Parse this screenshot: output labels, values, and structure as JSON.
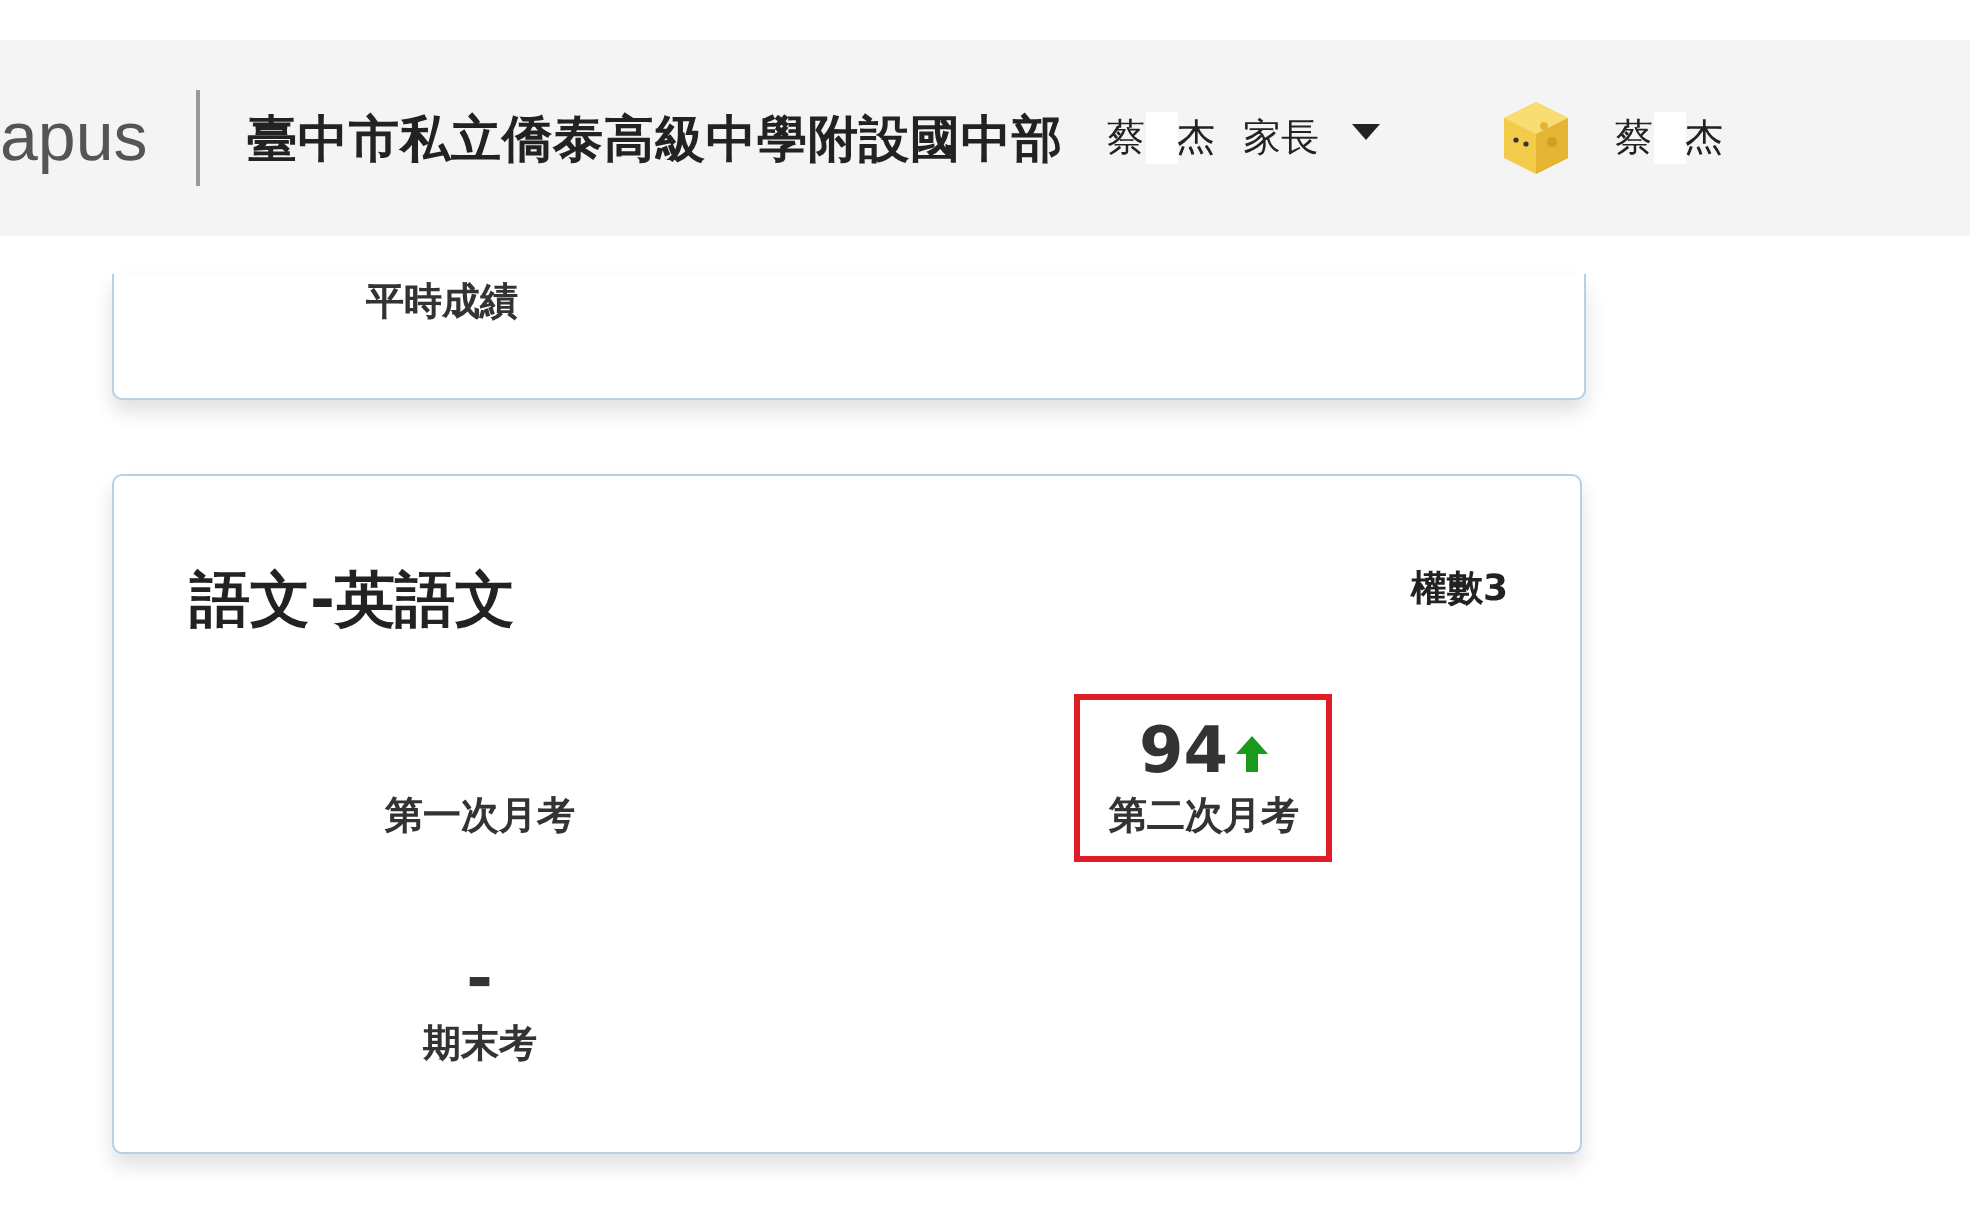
{
  "header": {
    "brand": "apus",
    "school": "臺中市私立僑泰高級中學附設國中部",
    "role_menu": {
      "name_parts": [
        "蔡",
        "杰"
      ],
      "role": "家長"
    },
    "user": {
      "name_parts": [
        "蔡",
        "杰"
      ]
    }
  },
  "cards": [
    {
      "kind": "clipped",
      "label": "平時成績"
    },
    {
      "kind": "subject",
      "title": "語文-英語文",
      "weight": "權數3",
      "exams": [
        {
          "label": "第一次月考",
          "rising": false,
          "highlighted": false
        },
        {
          "score": "94",
          "label": "第二次月考",
          "rising": true,
          "highlighted": true
        },
        {
          "score": "-",
          "label": "期末考",
          "rising": false,
          "highlighted": false
        }
      ]
    }
  ]
}
